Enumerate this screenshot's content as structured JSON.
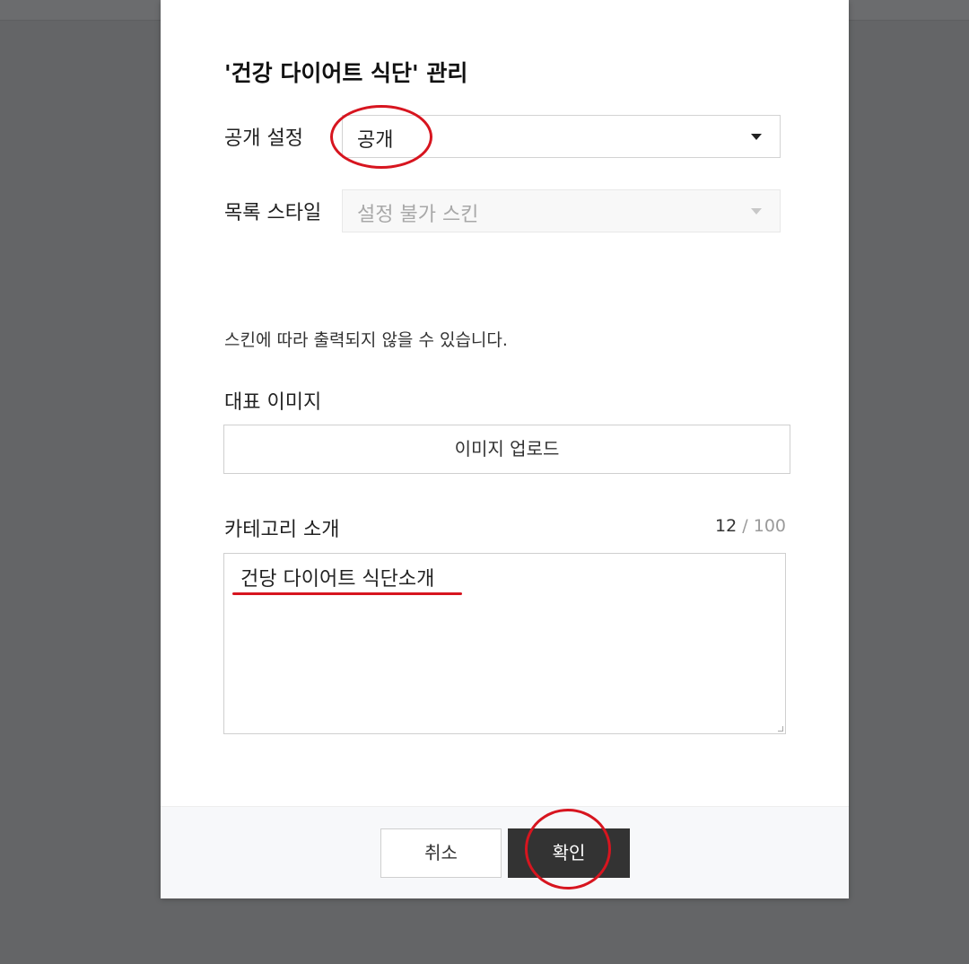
{
  "dialog": {
    "title": "'건강 다이어트 식단' 관리",
    "visibility": {
      "label": "공개 설정",
      "value": "공개"
    },
    "list_style": {
      "label": "목록 스타일",
      "value": "설정 불가 스킨"
    },
    "helper_text": "스킨에 따라 출력되지 않을 수 있습니다.",
    "image": {
      "label": "대표 이미지",
      "upload_label": "이미지 업로드"
    },
    "intro": {
      "label": "카테고리 소개",
      "count": "12",
      "separator": "/",
      "max": "100",
      "value": "건당 다이어트 식단소개"
    },
    "buttons": {
      "cancel": "취소",
      "confirm": "확인"
    }
  },
  "annotation_color": "#d7151f",
  "overlay_color": "#646567"
}
